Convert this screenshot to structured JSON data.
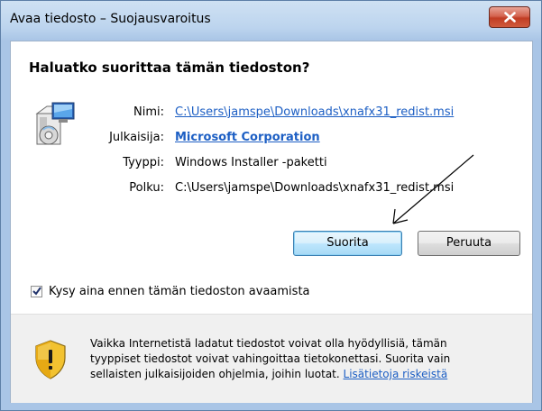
{
  "window": {
    "title": "Avaa tiedosto – Suojausvaroitus"
  },
  "dialog": {
    "question": "Haluatko suorittaa tämän tiedoston?",
    "fields": {
      "name_label": "Nimi:",
      "name_value": "C:\\Users\\jamspe\\Downloads\\xnafx31_redist.msi",
      "publisher_label": "Julkaisija:",
      "publisher_value": "Microsoft Corporation",
      "type_label": "Tyyppi:",
      "type_value": "Windows Installer -paketti",
      "path_label": "Polku:",
      "path_value": "C:\\Users\\jamspe\\Downloads\\xnafx31_redist.msi"
    },
    "buttons": {
      "run_label": "Suorita",
      "cancel_label": "Peruuta"
    },
    "checkbox": {
      "label": "Kysy aina ennen tämän tiedoston avaamista",
      "checked": true
    },
    "warning": {
      "text": "Vaikka Internetistä ladatut tiedostot voivat olla hyödyllisiä, tämän tyyppiset tiedostot voivat vahingoittaa tietokonettasi. Suorita vain sellaisten julkaisijoiden ohjelmia, joihin luotat.",
      "link_label": "Lisätietoja riskeistä"
    }
  },
  "icons": {
    "file": "installer-package-icon",
    "warning": "security-shield-icon",
    "close": "close-icon"
  },
  "colors": {
    "link": "#1d5fc4",
    "close_button": "#c13d24",
    "shield_yellow": "#f2c230"
  }
}
